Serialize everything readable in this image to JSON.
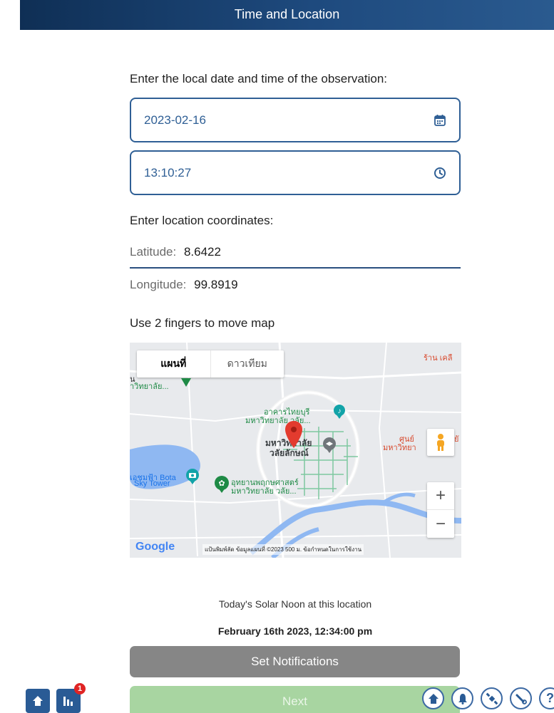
{
  "header": {
    "title": "Time and Location"
  },
  "datetime": {
    "prompt": "Enter the local date and time of the observation:",
    "date_value": "2023-02-16",
    "time_value": "13:10:27"
  },
  "location": {
    "prompt": "Enter location coordinates:",
    "latitude_label": "Latitude:",
    "latitude_value": "8.6422",
    "longitude_label": "Longitude:",
    "longitude_value": "99.8919"
  },
  "map": {
    "hint": "Use 2 fingers to move map",
    "type_map": "แผนที่",
    "type_satellite": "ดาวเทียม",
    "labels": {
      "top_left_1": "น",
      "top_left_2": "าวิทยาลัย...",
      "top_right": "ร้าน เคลื",
      "building_1a": "อาคารไทยบุรี",
      "building_1b": "มหาวิทยาลัย วลัย...",
      "center_1": "มหาวิทยาลัย",
      "center_2": "วลัยลักษณ์",
      "right_1": "ศูนย์",
      "right_2": "มหาวิทยา",
      "right_3": "ยั",
      "left_1": "เอชมฟ้า Bota",
      "left_2": "Sky Tower",
      "garden_1": "อุทยานพฤกษศาสตร์",
      "garden_2": "มหาวิทยาลัย วลัย..."
    },
    "google": "Google",
    "attribution": "แป้นพิมพ์ลัด   ข้อมูลแผนที่ ©2023   500 ม.                  ข้อกำหนดในการใช้งาน"
  },
  "solar": {
    "label": "Today's Solar Noon at this location",
    "value": "February 16th 2023, 12:34:00 pm"
  },
  "buttons": {
    "notifications": "Set Notifications",
    "next": "Next"
  },
  "badge_count": "1",
  "help_glyph": "?"
}
